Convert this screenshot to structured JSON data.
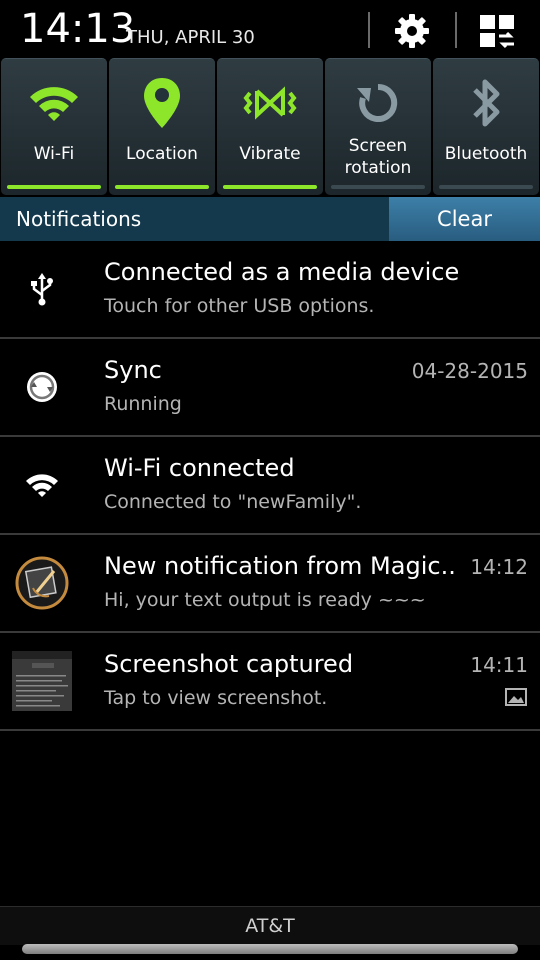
{
  "status": {
    "time": "14:13",
    "date": "THU, APRIL 30"
  },
  "quick_settings": [
    {
      "label": "Wi-Fi",
      "icon": "wifi-icon",
      "state": "on"
    },
    {
      "label": "Location",
      "icon": "location-pin-icon",
      "state": "on"
    },
    {
      "label": "Vibrate",
      "icon": "vibrate-icon",
      "state": "on"
    },
    {
      "label": "Screen rotation",
      "icon": "rotation-icon",
      "state": "off"
    },
    {
      "label": "Bluetooth",
      "icon": "bluetooth-icon",
      "state": "off"
    }
  ],
  "notifications_header": {
    "title": "Notifications",
    "clear_label": "Clear"
  },
  "notifications": [
    {
      "title": "Connected as a media device",
      "subtitle": "Touch for other USB options.",
      "time": "",
      "icon": "usb-icon"
    },
    {
      "title": "Sync",
      "subtitle": "Running",
      "time": "04-28-2015",
      "icon": "sync-icon"
    },
    {
      "title": "Wi-Fi connected",
      "subtitle": "Connected to \"newFamily\".",
      "time": "",
      "icon": "wifi-icon"
    },
    {
      "title": "New notification from Magic..",
      "subtitle": "Hi, your text output is ready ~~~",
      "time": "14:12",
      "icon": "magic-app-icon"
    },
    {
      "title": "Screenshot captured",
      "subtitle": "Tap to view screenshot.",
      "time": "14:11",
      "icon": "screenshot-thumbnail"
    }
  ],
  "carrier": "AT&T",
  "colors": {
    "toggle_on": "#8ee62b",
    "toggle_off_icon": "#8a9aa2",
    "header_blue": "#14394d",
    "clear_blue": "#3d7fa8"
  }
}
